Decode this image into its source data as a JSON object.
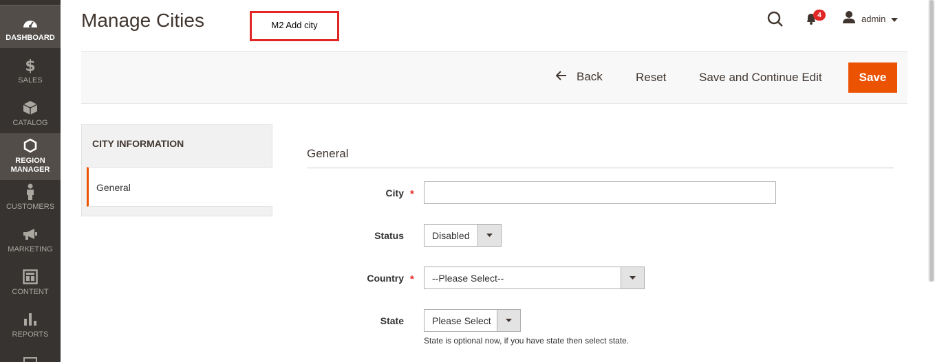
{
  "sidebar": {
    "items": [
      {
        "label": "Dashboard",
        "icon": "dashboard-icon"
      },
      {
        "label": "Sales",
        "icon": "dollar-icon"
      },
      {
        "label": "Catalog",
        "icon": "box-icon"
      },
      {
        "label": "Region Manager",
        "icon": "hexagon-icon"
      },
      {
        "label": "Customers",
        "icon": "person-icon"
      },
      {
        "label": "Marketing",
        "icon": "megaphone-icon"
      },
      {
        "label": "Content",
        "icon": "layout-icon"
      },
      {
        "label": "Reports",
        "icon": "bar-chart-icon"
      }
    ]
  },
  "header": {
    "title": "Manage Cities",
    "annotation": "M2 Add city",
    "notifications_count": "4",
    "user_name": "admin"
  },
  "actions": {
    "back": "Back",
    "reset": "Reset",
    "save_continue": "Save and Continue Edit",
    "save": "Save"
  },
  "tabs": {
    "title": "CITY INFORMATION",
    "items": [
      {
        "label": "General"
      }
    ]
  },
  "form": {
    "section_title": "General",
    "city": {
      "label": "City",
      "required": "*",
      "value": ""
    },
    "status": {
      "label": "Status",
      "value": "Disabled"
    },
    "country": {
      "label": "Country",
      "required": "*",
      "value": "--Please Select--"
    },
    "state": {
      "label": "State",
      "value": "Please Select",
      "note": "State is optional now, if you have state then select state."
    }
  },
  "colors": {
    "accent": "#eb5202",
    "sidebar": "#373330",
    "required": "#e22626"
  }
}
